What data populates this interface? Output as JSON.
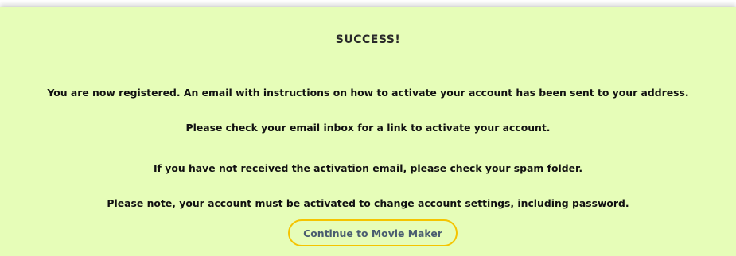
{
  "dialog": {
    "title": "SUCCESS!",
    "messages": [
      "You are now registered. An email with instructions on how to activate your account has been sent to your address.",
      "Please check your email inbox for a link to activate your account.",
      "If you have not received the activation email, please check your spam folder.",
      "Please note, your account must be activated to change account settings, including password."
    ],
    "continue_label": "Continue to Movie Maker",
    "colors": {
      "background": "#e6fdb8",
      "highlight": "#f5c400",
      "link_text": "#4a5d70"
    }
  }
}
